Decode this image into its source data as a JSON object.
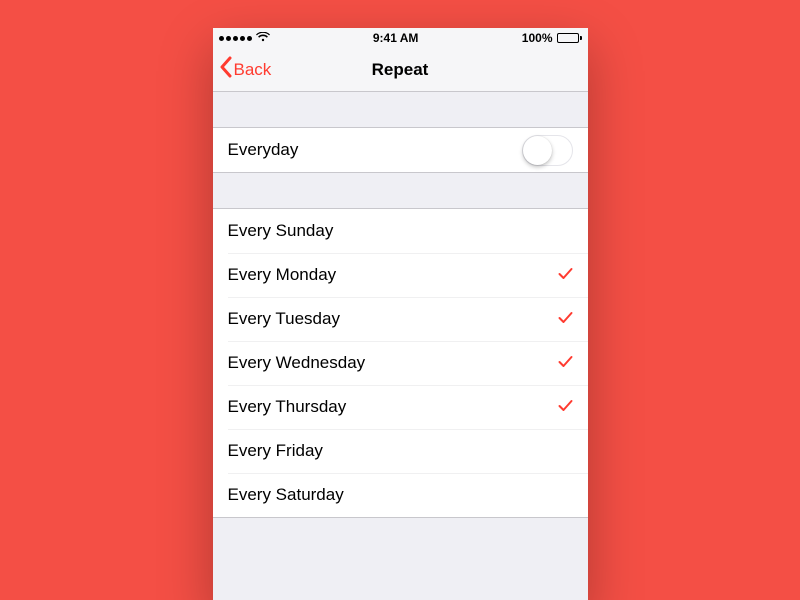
{
  "accent": "#ff3b30",
  "statusbar": {
    "time": "9:41 AM",
    "battery_pct": "100%"
  },
  "nav": {
    "back_label": "Back",
    "title": "Repeat"
  },
  "everyday": {
    "label": "Everyday",
    "on": false
  },
  "days": [
    {
      "label": "Every Sunday",
      "checked": false
    },
    {
      "label": "Every Monday",
      "checked": true
    },
    {
      "label": "Every Tuesday",
      "checked": true
    },
    {
      "label": "Every Wednesday",
      "checked": true
    },
    {
      "label": "Every Thursday",
      "checked": true
    },
    {
      "label": "Every Friday",
      "checked": false
    },
    {
      "label": "Every Saturday",
      "checked": false
    }
  ]
}
